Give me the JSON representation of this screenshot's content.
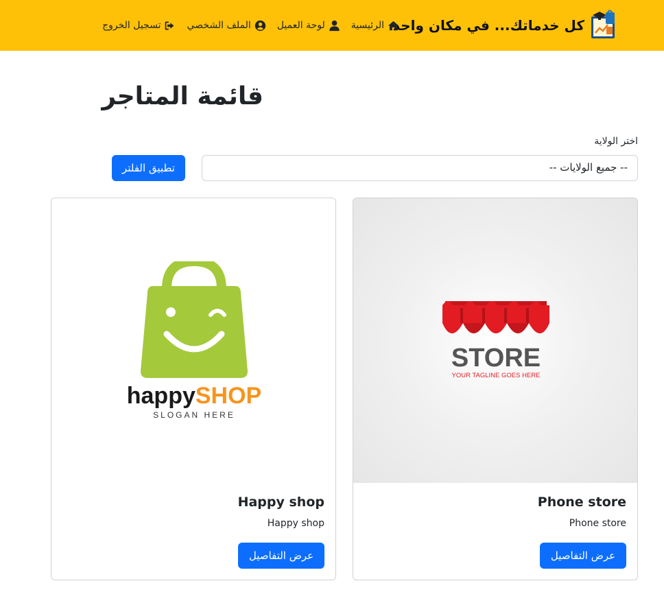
{
  "navbar": {
    "brand_title": "كل خدماتك... في مكان واحد",
    "links": [
      {
        "label": "الرئيسية",
        "icon": "home-icon"
      },
      {
        "label": "لوحة العميل",
        "icon": "user-icon"
      },
      {
        "label": "الملف الشخصي",
        "icon": "user-circle-icon"
      },
      {
        "label": "تسجيل الخروج",
        "icon": "sign-out-icon"
      }
    ]
  },
  "main": {
    "title": "قائمة المتاجر",
    "filter": {
      "label": "اختر الولاية",
      "selected": "-- جميع الولايات --",
      "button": "تطبيق الفلتر"
    },
    "stores": [
      {
        "name": "Phone store",
        "description": "Phone store",
        "button": "عرض التفاصيل",
        "logo": {
          "text": "STORE",
          "tagline": "YOUR TAGLINE GOES HERE"
        }
      },
      {
        "name": "Happy shop",
        "description": "Happy shop",
        "button": "عرض التفاصيل",
        "logo": {
          "text_happy": "happy",
          "text_shop": "SHOP",
          "slogan": "SLOGAN HERE"
        }
      }
    ]
  },
  "colors": {
    "navbar": "#ffc107",
    "primary": "#0d6efd",
    "awning_red": "#e31b23",
    "happy_green": "#a4c93b",
    "happy_orange": "#f7941d"
  }
}
